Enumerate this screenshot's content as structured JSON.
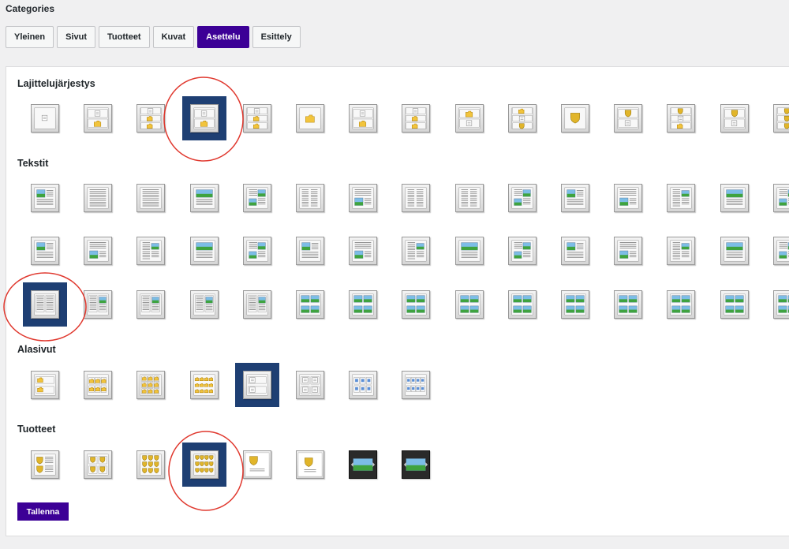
{
  "page": {
    "title": "Categories"
  },
  "tabs": [
    {
      "label": "Yleinen",
      "active": false
    },
    {
      "label": "Sivut",
      "active": false
    },
    {
      "label": "Tuotteet",
      "active": false
    },
    {
      "label": "Kuvat",
      "active": false
    },
    {
      "label": "Asettelu",
      "active": true
    },
    {
      "label": "Esittely",
      "active": false
    }
  ],
  "sections": [
    {
      "key": "sorting",
      "heading": "Lajittelujärjestys",
      "rows": [
        [
          "icon",
          "icon-folder",
          "icon-folder3",
          "icon-folder",
          "icon-folder3",
          "folder",
          "icon-folder",
          "icon-folder3",
          "folder2",
          "folder3",
          "shield",
          "icon-shield",
          "icon-shield3",
          "icon-shield",
          "shield3"
        ]
      ],
      "selected": [
        [
          0,
          3
        ]
      ]
    },
    {
      "key": "texts",
      "heading": "Tekstit",
      "rows": [
        [
          "img-text",
          "text",
          "text2",
          "img-text",
          "text-img",
          "textcol2",
          "img-textcol",
          "textcol2b",
          "textcol2c",
          "img-pair",
          "text-img2",
          "text-img2b",
          "img-text-grid",
          "img-text-grid2",
          "img-text-grid3"
        ],
        [
          "text-img-l",
          "img-text-l",
          "img-text-l2",
          "img-text-r",
          "text-img-r",
          "text-img-r2",
          "img-text-r3",
          "img-text-r4",
          "img-text-r5",
          "img-text-r6",
          "img-text-r7",
          "img-text-r8",
          "img-text-r9",
          "img-text-r10",
          "img-text-r11"
        ],
        [
          "grid2text",
          "grid2img",
          "grid2imgb",
          "grid2imgc",
          "grid2imgd",
          "grid4img",
          "grid4imgb",
          "grid4imgc",
          "grid4imgd",
          "grid4imge",
          "grid4imgf",
          "grid4imgg",
          "grid4imgh",
          "grid4imgi",
          "grid4imgj"
        ]
      ],
      "selected": [
        [
          2,
          0
        ]
      ]
    },
    {
      "key": "subpages",
      "heading": "Alasivut",
      "rows": [
        [
          "folder-list",
          "folder-grid3",
          "folder-grid4",
          "folder-grid6",
          "icon-list",
          "icon-grid2",
          "icon-grid3",
          "icon-grid4"
        ]
      ],
      "selected": [
        [
          0,
          4
        ]
      ]
    },
    {
      "key": "products",
      "heading": "Tuotteet",
      "rows": [
        [
          "shield-list",
          "shield-grid2",
          "shield-grid3",
          "shield-grid4",
          "shield-card",
          "shield-single",
          "slider",
          "slider2"
        ]
      ],
      "selected": [
        [
          0,
          3
        ]
      ]
    }
  ],
  "save_button": {
    "label": "Tallenna"
  },
  "colors": {
    "accent": "#3c0096",
    "selected": "#1e3f73",
    "annotation": "#e0382e"
  }
}
